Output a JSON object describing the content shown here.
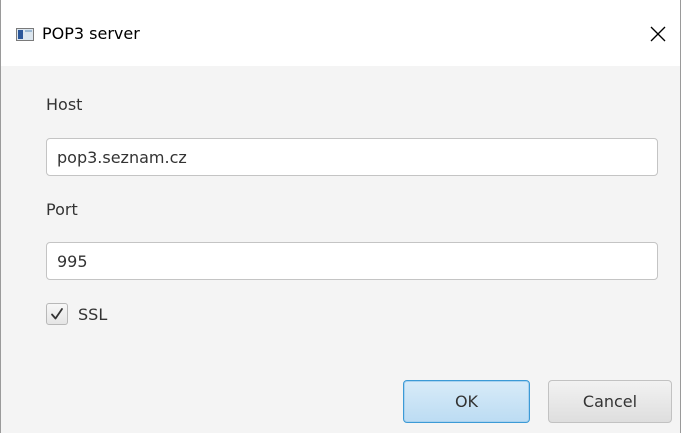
{
  "window": {
    "title": "POP3 server",
    "icons": {
      "app": "app-window-icon",
      "close": "close-icon"
    }
  },
  "form": {
    "host_label": "Host",
    "host_value": "pop3.seznam.cz",
    "port_label": "Port",
    "port_value": "995",
    "ssl_label": "SSL",
    "ssl_checked": true
  },
  "buttons": {
    "ok_label": "OK",
    "cancel_label": "Cancel"
  },
  "colors": {
    "accent": "#3c9ad6",
    "dialog_background": "#f4f4f4"
  }
}
